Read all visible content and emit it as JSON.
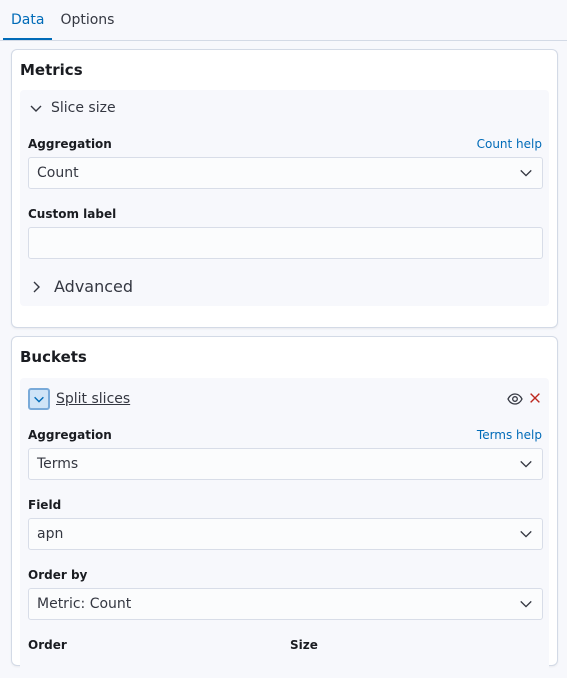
{
  "tabs": [
    {
      "label": "Data",
      "active": true
    },
    {
      "label": "Options",
      "active": false
    }
  ],
  "metrics": {
    "title": "Metrics",
    "accordion_label": "Slice size",
    "aggregation_label": "Aggregation",
    "aggregation_help": "Count help",
    "aggregation_value": "Count",
    "custom_label_label": "Custom label",
    "custom_label_value": "",
    "advanced_label": "Advanced"
  },
  "buckets": {
    "title": "Buckets",
    "accordion_label": "Split slices",
    "aggregation_label": "Aggregation",
    "aggregation_help": "Terms help",
    "aggregation_value": "Terms",
    "field_label": "Field",
    "field_value": "apn",
    "order_by_label": "Order by",
    "order_by_value": "Metric: Count",
    "order_label": "Order",
    "size_label": "Size"
  },
  "icons": {
    "chevron-down": "chevron-down-icon",
    "chevron-right": "chevron-right-icon",
    "eye": "eye-icon",
    "remove": "cross-icon",
    "caret": "arrow-down-icon"
  },
  "colors": {
    "accent": "#006bb8",
    "danger": "#bd271e",
    "panel_bg": "#ffffff",
    "block_bg": "#f7f8fc"
  }
}
